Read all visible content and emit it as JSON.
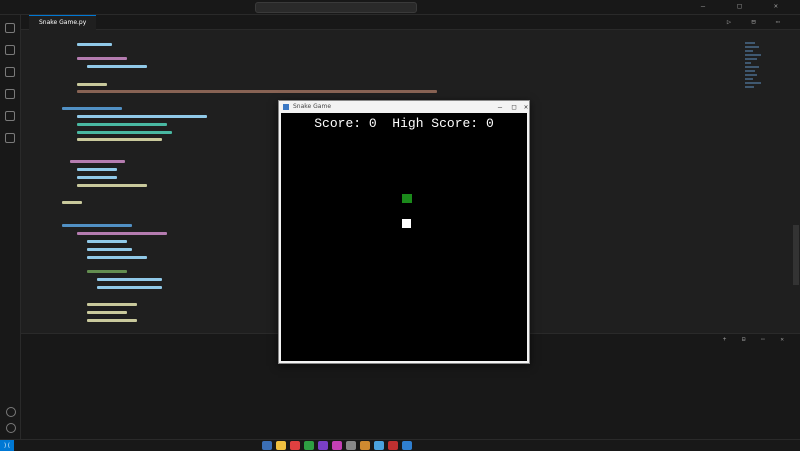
{
  "editor": {
    "tab_label": "Snake Game.py"
  },
  "game": {
    "window_title": "Snake Game",
    "score_label": "Score:",
    "score": "0",
    "high_score_label": "High Score:",
    "high_score": "0",
    "minimize": "—",
    "maximize": "□",
    "close": "✕"
  },
  "colors": {
    "editor_bg": "#1f1f1f",
    "game_bg": "#000000",
    "food": "#1b8a1b",
    "snake": "#ffffff",
    "accent": "#0078d4"
  }
}
